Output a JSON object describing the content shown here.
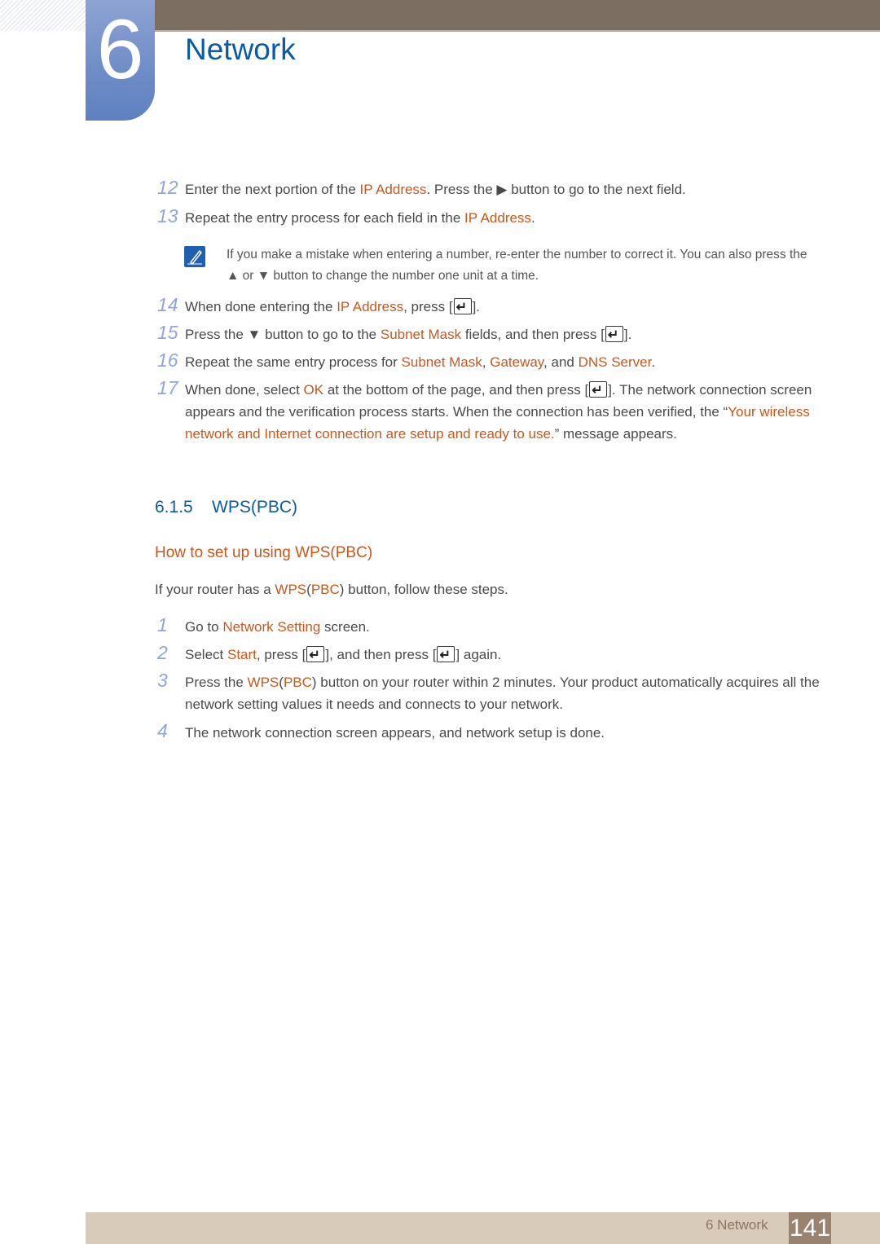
{
  "chapter": {
    "number": "6",
    "title": "Network"
  },
  "steps_a": [
    {
      "num": "12",
      "parts": [
        "Enter the next portion of the ",
        "IP Address",
        ". Press the ▶ button to go to the next field."
      ]
    },
    {
      "num": "13",
      "parts": [
        "Repeat the entry process for each field in the ",
        "IP Address",
        "."
      ]
    },
    {
      "num": "14",
      "parts": [
        "When done entering the ",
        "IP Address",
        ", press [",
        "]."
      ]
    },
    {
      "num": "15",
      "parts": [
        "Press the ▼ button to go to the ",
        "Subnet Mask",
        " fields, and then press [",
        "]."
      ]
    },
    {
      "num": "16",
      "parts": [
        "Repeat the same entry process for ",
        "Subnet Mask",
        ", ",
        "Gateway",
        ", and ",
        "DNS Server",
        "."
      ]
    },
    {
      "num": "17",
      "parts": [
        "When done, select ",
        "OK",
        " at the bottom of the page, and then press [",
        "]. The network connection screen appears and the verification process starts. When the connection has been verified, the “",
        "Your wireless network and Internet connection are setup and ready to use.",
        "” message appears."
      ]
    }
  ],
  "note": {
    "text": "If you make a mistake when entering a number, re-enter the number to correct it. You can also press the ▲ or ▼ button to change the number one unit at a time."
  },
  "section": {
    "number": "6.1.5",
    "title": "WPS(PBC)"
  },
  "subsection": {
    "title": "How to set up using WPS(PBC)"
  },
  "intro": {
    "parts": [
      "If your router has a ",
      "WPS",
      "(",
      "PBC",
      ") button, follow these steps."
    ]
  },
  "steps_b": [
    {
      "num": "1",
      "parts": [
        "Go to ",
        "Network Setting",
        " screen."
      ]
    },
    {
      "num": "2",
      "parts": [
        "Select ",
        "Start",
        ", press [",
        "], and then press [",
        "] again."
      ]
    },
    {
      "num": "3",
      "parts": [
        "Press the ",
        "WPS",
        "(",
        "PBC",
        ") button on your router within 2 minutes. Your product automatically acquires all the network setting values it needs and connects to your network."
      ]
    },
    {
      "num": "4",
      "parts": [
        "The network connection screen appears, and network setup is done."
      ]
    }
  ],
  "footer": {
    "label": "6 Network",
    "page": "141"
  }
}
